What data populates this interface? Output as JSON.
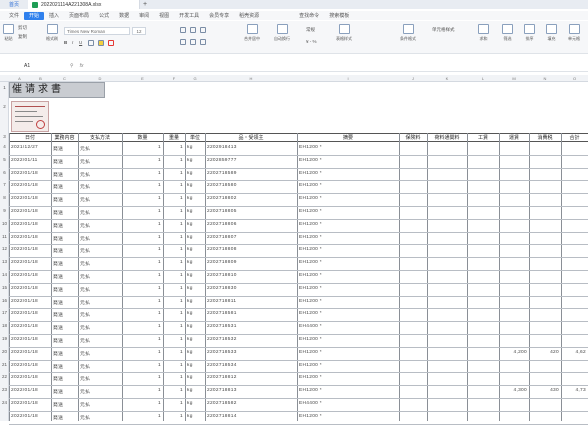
{
  "tabs": {
    "home": "首页",
    "file": "2022021114A221308A.xlsx",
    "new_tab": "+"
  },
  "menu": [
    "文件",
    "开始",
    "插入",
    "页面布局",
    "公式",
    "数据",
    "审阅",
    "视图",
    "开发工具",
    "会员专享",
    "稻壳资源",
    "查找命令",
    "搜索模板"
  ],
  "menu_active_index": 1,
  "ribbon": {
    "paste": "粘贴",
    "cut": "剪切",
    "copy": "复制",
    "format_painter": "格式刷",
    "font_name": "Times New Roman",
    "font_size": "12",
    "merge_center": "合并居中",
    "wrap_text": "自动换行",
    "number_format": "常规",
    "table_style": "表格样式",
    "cond_format": "条件格式",
    "cell_style": "单元格样式",
    "sum": "求和",
    "filter": "筛选",
    "sort": "排序",
    "fill": "填充",
    "cell": "单元格"
  },
  "formula_bar": {
    "name_box": "A1",
    "fx": "fx"
  },
  "columns": [
    "A",
    "B",
    "C",
    "D",
    "E",
    "F",
    "G",
    "H",
    "I",
    "J",
    "K",
    "L",
    "M",
    "N",
    "O"
  ],
  "title": "催请求書",
  "table_headers": [
    "日付",
    "業務内容",
    "支払方法",
    "数量",
    "重量",
    "単位",
    "品・受領主",
    "摘要",
    "保険料",
    "荷料通関料",
    "工賃",
    "運賃",
    "消費税",
    "合計"
  ],
  "row_numbers": [
    "1",
    "2",
    "3",
    "4",
    "5",
    "6",
    "7",
    "8",
    "9",
    "10",
    "11",
    "12",
    "13",
    "14",
    "15",
    "16",
    "17",
    "18",
    "19",
    "20",
    "21",
    "22",
    "23",
    "24"
  ],
  "rows": [
    {
      "date": "2021/12/27",
      "type": "発送",
      "pay": "元払",
      "qty": "1",
      "wt": "1",
      "unit": "kg",
      "track": "2202918413",
      "memo": "EH1200 *",
      "m": "",
      "n": "",
      "o": ""
    },
    {
      "date": "2022/01/11",
      "type": "発送",
      "pay": "元払",
      "qty": "1",
      "wt": "1",
      "unit": "kg",
      "track": "2202859777",
      "memo": "EH1200 *",
      "m": "",
      "n": "",
      "o": ""
    },
    {
      "date": "2022/01/18",
      "type": "発送",
      "pay": "元払",
      "qty": "1",
      "wt": "1",
      "unit": "kg",
      "track": "2202718589",
      "memo": "EH1200 *",
      "m": "",
      "n": "",
      "o": ""
    },
    {
      "date": "2022/01/18",
      "type": "発送",
      "pay": "元払",
      "qty": "1",
      "wt": "1",
      "unit": "kg",
      "track": "2202718580",
      "memo": "EH1200 *",
      "m": "",
      "n": "",
      "o": ""
    },
    {
      "date": "2022/01/18",
      "type": "発送",
      "pay": "元払",
      "qty": "1",
      "wt": "1",
      "unit": "kg",
      "track": "2202718802",
      "memo": "EH1200 *",
      "m": "",
      "n": "",
      "o": ""
    },
    {
      "date": "2022/01/18",
      "type": "発送",
      "pay": "元払",
      "qty": "1",
      "wt": "1",
      "unit": "kg",
      "track": "2202718805",
      "memo": "EH1200 *",
      "m": "",
      "n": "",
      "o": ""
    },
    {
      "date": "2022/01/18",
      "type": "発送",
      "pay": "元払",
      "qty": "1",
      "wt": "1",
      "unit": "kg",
      "track": "2202718806",
      "memo": "EH1200 *",
      "m": "",
      "n": "",
      "o": ""
    },
    {
      "date": "2022/01/18",
      "type": "発送",
      "pay": "元払",
      "qty": "1",
      "wt": "1",
      "unit": "kg",
      "track": "2202718807",
      "memo": "EH1200 *",
      "m": "",
      "n": "",
      "o": ""
    },
    {
      "date": "2022/01/18",
      "type": "発送",
      "pay": "元払",
      "qty": "1",
      "wt": "1",
      "unit": "kg",
      "track": "2202718808",
      "memo": "EH1200 *",
      "m": "",
      "n": "",
      "o": ""
    },
    {
      "date": "2022/01/18",
      "type": "発送",
      "pay": "元払",
      "qty": "1",
      "wt": "1",
      "unit": "kg",
      "track": "2202718809",
      "memo": "EH1200 *",
      "m": "",
      "n": "",
      "o": ""
    },
    {
      "date": "2022/01/18",
      "type": "発送",
      "pay": "元払",
      "qty": "1",
      "wt": "1",
      "unit": "kg",
      "track": "2202718810",
      "memo": "EH1200 *",
      "m": "",
      "n": "",
      "o": ""
    },
    {
      "date": "2022/01/18",
      "type": "発送",
      "pay": "元払",
      "qty": "1",
      "wt": "1",
      "unit": "kg",
      "track": "2202718830",
      "memo": "EH1200 *",
      "m": "",
      "n": "",
      "o": ""
    },
    {
      "date": "2022/01/18",
      "type": "発送",
      "pay": "元払",
      "qty": "1",
      "wt": "1",
      "unit": "kg",
      "track": "2202718811",
      "memo": "EH1200 *",
      "m": "",
      "n": "",
      "o": ""
    },
    {
      "date": "2022/01/18",
      "type": "発送",
      "pay": "元払",
      "qty": "1",
      "wt": "1",
      "unit": "kg",
      "track": "2202718581",
      "memo": "EH1200 *",
      "m": "",
      "n": "",
      "o": ""
    },
    {
      "date": "2022/01/18",
      "type": "発送",
      "pay": "元払",
      "qty": "1",
      "wt": "1",
      "unit": "kg",
      "track": "2202718531",
      "memo": "EH4400 *",
      "m": "",
      "n": "",
      "o": ""
    },
    {
      "date": "2022/01/18",
      "type": "発送",
      "pay": "元払",
      "qty": "1",
      "wt": "1",
      "unit": "kg",
      "track": "2202718532",
      "memo": "EH1200 *",
      "m": "",
      "n": "",
      "o": ""
    },
    {
      "date": "2022/01/18",
      "type": "発送",
      "pay": "元払",
      "qty": "1",
      "wt": "1",
      "unit": "kg",
      "track": "2202718533",
      "memo": "EH1200 *",
      "m": "4,200",
      "n": "420",
      "o": "4,62"
    },
    {
      "date": "2022/01/18",
      "type": "発送",
      "pay": "元払",
      "qty": "1",
      "wt": "1",
      "unit": "kg",
      "track": "2202718534",
      "memo": "EH1200 *",
      "m": "",
      "n": "",
      "o": ""
    },
    {
      "date": "2022/01/18",
      "type": "発送",
      "pay": "元払",
      "qty": "1",
      "wt": "1",
      "unit": "kg",
      "track": "2202718812",
      "memo": "EH1200 *",
      "m": "",
      "n": "",
      "o": ""
    },
    {
      "date": "2022/01/18",
      "type": "発送",
      "pay": "元払",
      "qty": "1",
      "wt": "1",
      "unit": "kg",
      "track": "2202718813",
      "memo": "EH1200 *",
      "m": "4,300",
      "n": "430",
      "o": "4,73"
    },
    {
      "date": "2022/01/18",
      "type": "発送",
      "pay": "元払",
      "qty": "1",
      "wt": "1",
      "unit": "kg",
      "track": "2202718582",
      "memo": "EH4400 *",
      "m": "",
      "n": "",
      "o": ""
    },
    {
      "date": "2022/01/18",
      "type": "発送",
      "pay": "元払",
      "qty": "1",
      "wt": "1",
      "unit": "kg",
      "track": "2202718814",
      "memo": "EH1200 *",
      "m": "",
      "n": "",
      "o": ""
    }
  ],
  "colors": {
    "accent": "#2f80ed",
    "title_fill": "#c9ccd1",
    "grid_line": "#b8bdc4"
  }
}
